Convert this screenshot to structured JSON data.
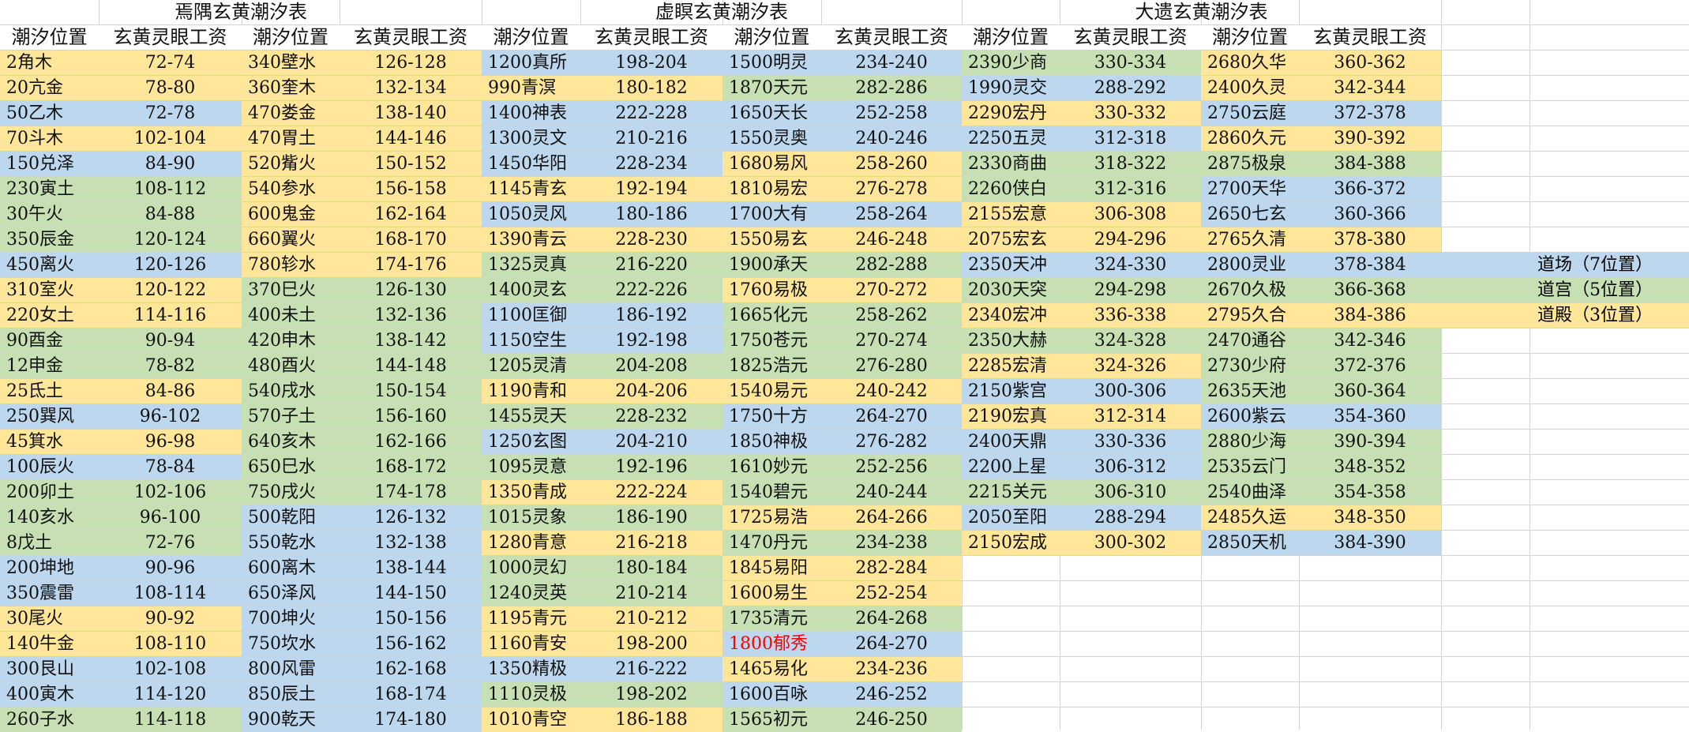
{
  "headers": {
    "pos": "潮汐位置",
    "apt": "玄黄灵眼工资"
  },
  "tables": [
    {
      "title": "焉隅玄黄潮汐表",
      "left": [
        [
          "2角木",
          "72-74",
          "yellow"
        ],
        [
          "20亢金",
          "78-80",
          "yellow"
        ],
        [
          "50乙木",
          "72-78",
          "blue"
        ],
        [
          "70斗木",
          "102-104",
          "yellow"
        ],
        [
          "150兑泽",
          "84-90",
          "blue"
        ],
        [
          "230寅土",
          "108-112",
          "green"
        ],
        [
          "30午火",
          "84-88",
          "green"
        ],
        [
          "350辰金",
          "120-124",
          "green"
        ],
        [
          "450离火",
          "120-126",
          "blue"
        ],
        [
          "310室火",
          "120-122",
          "yellow"
        ],
        [
          "220女土",
          "114-116",
          "yellow"
        ],
        [
          "90酉金",
          "90-94",
          "green"
        ],
        [
          "12申金",
          "78-82",
          "green"
        ],
        [
          "25氐土",
          "84-86",
          "yellow"
        ],
        [
          "250巽风",
          "96-102",
          "blue"
        ],
        [
          "45箕水",
          "96-98",
          "yellow"
        ],
        [
          "100辰火",
          "78-84",
          "blue"
        ],
        [
          "200卯土",
          "102-106",
          "green"
        ],
        [
          "140亥水",
          "96-100",
          "green"
        ],
        [
          "8戊土",
          "72-76",
          "green"
        ],
        [
          "200坤地",
          "90-96",
          "blue"
        ],
        [
          "350震雷",
          "108-114",
          "blue"
        ],
        [
          "30尾火",
          "90-92",
          "yellow"
        ],
        [
          "140牛金",
          "108-110",
          "yellow"
        ],
        [
          "300艮山",
          "102-108",
          "blue"
        ],
        [
          "400寅木",
          "114-120",
          "blue"
        ],
        [
          "260子水",
          "114-118",
          "green"
        ]
      ],
      "right": [
        [
          "340壁水",
          "126-128",
          "yellow"
        ],
        [
          "360奎木",
          "132-134",
          "yellow"
        ],
        [
          "470娄金",
          "138-140",
          "yellow"
        ],
        [
          "470胃土",
          "144-146",
          "yellow"
        ],
        [
          "520觜火",
          "150-152",
          "yellow"
        ],
        [
          "540参水",
          "156-158",
          "yellow"
        ],
        [
          "600鬼金",
          "162-164",
          "yellow"
        ],
        [
          "660翼火",
          "168-170",
          "yellow"
        ],
        [
          "780轸水",
          "174-176",
          "yellow"
        ],
        [
          "370巳火",
          "126-130",
          "green"
        ],
        [
          "400未土",
          "132-136",
          "green"
        ],
        [
          "420申木",
          "138-142",
          "green"
        ],
        [
          "480酉火",
          "144-148",
          "green"
        ],
        [
          "540戌水",
          "150-154",
          "green"
        ],
        [
          "570子土",
          "156-160",
          "green"
        ],
        [
          "640亥木",
          "162-166",
          "green"
        ],
        [
          "650巳水",
          "168-172",
          "green"
        ],
        [
          "750戌火",
          "174-178",
          "green"
        ],
        [
          "500乾阳",
          "126-132",
          "blue"
        ],
        [
          "550乾水",
          "132-138",
          "blue"
        ],
        [
          "600离木",
          "138-144",
          "blue"
        ],
        [
          "650泽风",
          "144-150",
          "blue"
        ],
        [
          "700坤火",
          "150-156",
          "blue"
        ],
        [
          "750坎水",
          "156-162",
          "blue"
        ],
        [
          "800风雷",
          "162-168",
          "blue"
        ],
        [
          "850辰土",
          "168-174",
          "blue"
        ],
        [
          "900乾天",
          "174-180",
          "blue"
        ]
      ]
    },
    {
      "title": "虚瞑玄黄潮汐表",
      "left": [
        [
          "1200真所",
          "198-204",
          "blue"
        ],
        [
          "990青溟",
          "180-182",
          "yellow"
        ],
        [
          "1400神表",
          "222-228",
          "blue"
        ],
        [
          "1300灵文",
          "210-216",
          "blue"
        ],
        [
          "1450华阳",
          "228-234",
          "blue"
        ],
        [
          "1145青玄",
          "192-194",
          "yellow"
        ],
        [
          "1050灵风",
          "180-186",
          "blue"
        ],
        [
          "1390青云",
          "228-230",
          "yellow"
        ],
        [
          "1325灵真",
          "216-220",
          "green"
        ],
        [
          "1400灵玄",
          "222-226",
          "green"
        ],
        [
          "1100匡御",
          "186-192",
          "blue"
        ],
        [
          "1150空生",
          "192-198",
          "blue"
        ],
        [
          "1205灵清",
          "204-208",
          "green"
        ],
        [
          "1190青和",
          "204-206",
          "yellow"
        ],
        [
          "1455灵天",
          "228-232",
          "green"
        ],
        [
          "1250玄图",
          "204-210",
          "blue"
        ],
        [
          "1095灵意",
          "192-196",
          "green"
        ],
        [
          "1350青成",
          "222-224",
          "yellow"
        ],
        [
          "1015灵象",
          "186-190",
          "green"
        ],
        [
          "1280青意",
          "216-218",
          "yellow"
        ],
        [
          "1000灵幻",
          "180-184",
          "green"
        ],
        [
          "1240灵英",
          "210-214",
          "green"
        ],
        [
          "1195青元",
          "210-212",
          "yellow"
        ],
        [
          "1160青安",
          "198-200",
          "yellow"
        ],
        [
          "1350精极",
          "216-222",
          "blue"
        ],
        [
          "1110灵极",
          "198-202",
          "green"
        ],
        [
          "1010青空",
          "186-188",
          "yellow"
        ]
      ],
      "right": [
        [
          "1500明灵",
          "234-240",
          "blue"
        ],
        [
          "1870天元",
          "282-286",
          "green"
        ],
        [
          "1650天长",
          "252-258",
          "blue"
        ],
        [
          "1550灵奥",
          "240-246",
          "blue"
        ],
        [
          "1680易风",
          "258-260",
          "yellow"
        ],
        [
          "1810易宏",
          "276-278",
          "yellow"
        ],
        [
          "1700大有",
          "258-264",
          "blue"
        ],
        [
          "1550易玄",
          "246-248",
          "yellow"
        ],
        [
          "1900承天",
          "282-288",
          "green"
        ],
        [
          "1760易极",
          "270-272",
          "yellow"
        ],
        [
          "1665化元",
          "258-262",
          "green"
        ],
        [
          "1750苍元",
          "270-274",
          "green"
        ],
        [
          "1825浩元",
          "276-280",
          "green"
        ],
        [
          "1540易元",
          "240-242",
          "yellow"
        ],
        [
          "1750十方",
          "264-270",
          "blue"
        ],
        [
          "1850神极",
          "276-282",
          "blue"
        ],
        [
          "1610妙元",
          "252-256",
          "green"
        ],
        [
          "1540碧元",
          "240-244",
          "green"
        ],
        [
          "1725易浩",
          "264-266",
          "yellow"
        ],
        [
          "1470丹元",
          "234-238",
          "green"
        ],
        [
          "1845易阳",
          "282-284",
          "yellow"
        ],
        [
          "1600易生",
          "252-254",
          "yellow"
        ],
        [
          "1735清元",
          "264-268",
          "green"
        ],
        [
          "1800郁秀",
          "264-270",
          "blue",
          "red"
        ],
        [
          "1465易化",
          "234-236",
          "yellow"
        ],
        [
          "1600百咏",
          "246-252",
          "blue"
        ],
        [
          "1565初元",
          "246-250",
          "green"
        ]
      ]
    },
    {
      "title": "大遗玄黄潮汐表",
      "left": [
        [
          "2390少商",
          "330-334",
          "green"
        ],
        [
          "1990灵交",
          "288-292",
          "blue"
        ],
        [
          "2290宏丹",
          "330-332",
          "yellow"
        ],
        [
          "2250五灵",
          "312-318",
          "blue"
        ],
        [
          "2330商曲",
          "318-322",
          "green"
        ],
        [
          "2260侠白",
          "312-316",
          "green"
        ],
        [
          "2155宏意",
          "306-308",
          "yellow"
        ],
        [
          "2075宏玄",
          "294-296",
          "yellow"
        ],
        [
          "2350天冲",
          "324-330",
          "blue"
        ],
        [
          "2030天突",
          "294-298",
          "green"
        ],
        [
          "2340宏冲",
          "336-338",
          "yellow"
        ],
        [
          "2350大赫",
          "324-328",
          "green"
        ],
        [
          "2285宏清",
          "324-326",
          "yellow"
        ],
        [
          "2150紫宫",
          "300-306",
          "blue"
        ],
        [
          "2190宏真",
          "312-314",
          "yellow"
        ],
        [
          "2400天鼎",
          "330-336",
          "blue"
        ],
        [
          "2200上星",
          "306-312",
          "blue"
        ],
        [
          "2215关元",
          "306-310",
          "green"
        ],
        [
          "2050至阳",
          "288-294",
          "blue"
        ],
        [
          "2150宏成",
          "300-302",
          "yellow"
        ]
      ],
      "right": [
        [
          "2680久华",
          "360-362",
          "yellow"
        ],
        [
          "2400久灵",
          "342-344",
          "yellow"
        ],
        [
          "2750云庭",
          "372-378",
          "blue"
        ],
        [
          "2860久元",
          "390-392",
          "yellow"
        ],
        [
          "2875极泉",
          "384-388",
          "green"
        ],
        [
          "2700天华",
          "366-372",
          "blue"
        ],
        [
          "2650七玄",
          "360-366",
          "blue"
        ],
        [
          "2765久清",
          "378-380",
          "yellow"
        ],
        [
          "2800灵业",
          "378-384",
          "blue"
        ],
        [
          "2670久极",
          "366-368",
          "green"
        ],
        [
          "2795久合",
          "384-386",
          "yellow"
        ],
        [
          "2470通谷",
          "342-346",
          "green"
        ],
        [
          "2730少府",
          "372-376",
          "green"
        ],
        [
          "2635天池",
          "360-364",
          "green"
        ],
        [
          "2600紫云",
          "354-360",
          "blue"
        ],
        [
          "2880少海",
          "390-394",
          "green"
        ],
        [
          "2535云门",
          "348-352",
          "green"
        ],
        [
          "2540曲泽",
          "354-358",
          "green"
        ],
        [
          "2485久运",
          "348-350",
          "yellow"
        ],
        [
          "2850天机",
          "384-390",
          "blue"
        ]
      ]
    }
  ],
  "legend": [
    {
      "text": "道场（7位置）",
      "color": "blue"
    },
    {
      "text": "道宫（5位置）",
      "color": "green"
    },
    {
      "text": "道殿（3位置）",
      "color": "yellow"
    }
  ]
}
